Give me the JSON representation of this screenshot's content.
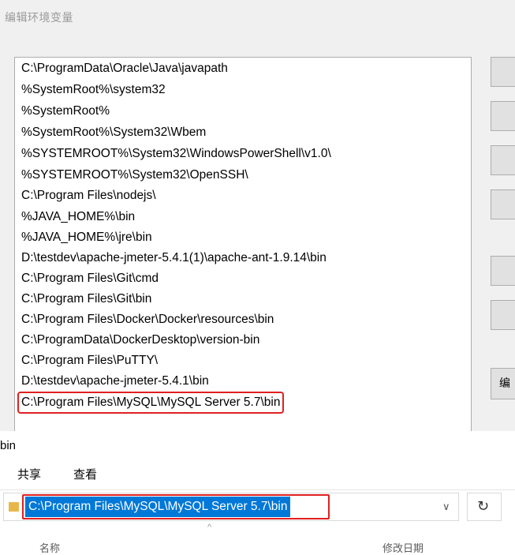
{
  "dialog": {
    "title": "编辑环境变量",
    "paths": [
      "C:\\ProgramData\\Oracle\\Java\\javapath",
      "%SystemRoot%\\system32",
      "%SystemRoot%",
      "%SystemRoot%\\System32\\Wbem",
      "%SYSTEMROOT%\\System32\\WindowsPowerShell\\v1.0\\",
      "%SYSTEMROOT%\\System32\\OpenSSH\\",
      "C:\\Program Files\\nodejs\\",
      "%JAVA_HOME%\\bin",
      "%JAVA_HOME%\\jre\\bin",
      "D:\\testdev\\apache-jmeter-5.4.1(1)\\apache-ant-1.9.14\\bin",
      "C:\\Program Files\\Git\\cmd",
      "C:\\Program Files\\Git\\bin",
      "C:\\Program Files\\Docker\\Docker\\resources\\bin",
      "C:\\ProgramData\\DockerDesktop\\version-bin",
      "C:\\Program Files\\PuTTY\\",
      "D:\\testdev\\apache-jmeter-5.4.1\\bin",
      "C:\\Program Files\\MySQL\\MySQL Server 5.7\\bin"
    ],
    "side_button_text": "编"
  },
  "explorer": {
    "folder_name": "bin",
    "tabs": [
      "共享",
      "查看"
    ],
    "address": "C:\\Program Files\\MySQL\\MySQL Server 5.7\\bin",
    "dropdown_glyph": "∨",
    "refresh_glyph": "↻",
    "sort_glyph": "^",
    "col_name": "名称",
    "col_modified": "修改日期"
  },
  "colors": {
    "highlight": "#e02020",
    "selection": "#0078d7"
  }
}
